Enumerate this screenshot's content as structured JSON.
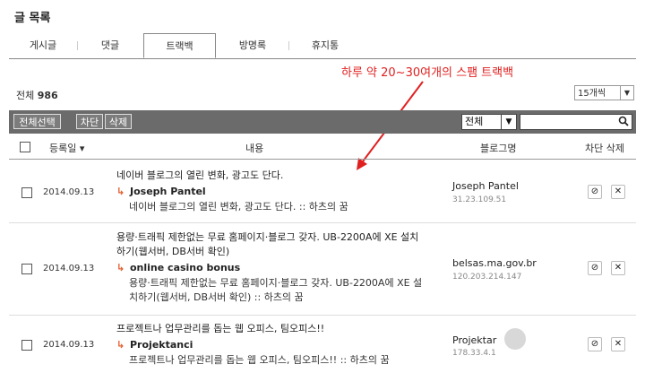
{
  "page": {
    "title": "글 목록"
  },
  "tabs": [
    {
      "label": "게시글",
      "active": false
    },
    {
      "label": "댓글",
      "active": false
    },
    {
      "label": "트랙백",
      "active": true
    },
    {
      "label": "방명록",
      "active": false
    },
    {
      "label": "휴지통",
      "active": false
    }
  ],
  "annotation": {
    "text": "하루 약 20~30여개의 스팸 트랙백",
    "color": "#e02020"
  },
  "summary": {
    "total_label": "전체",
    "total_count": "986"
  },
  "per_page": {
    "selected": "15개씩",
    "arrow": "▼"
  },
  "toolbar": {
    "select_all_label": "전체선택",
    "block_label": "차단",
    "delete_label": "삭제",
    "filter_selected": "전체",
    "filter_arrow": "▼",
    "search_value": "",
    "search_icon": "🔍"
  },
  "table": {
    "headers": {
      "date": "등록일 ▾",
      "content": "내용",
      "blog": "블로그명",
      "block_delete": "차단 삭제"
    },
    "rows": [
      {
        "date": "2014.09.13",
        "title": "네이버 블로그의 열린 변화, 광고도 단다.",
        "author": "Joseph Pantel",
        "excerpt": "네이버 블로그의 열린 변화, 광고도 단다. :: 하츠의 꿈",
        "blog_name": "Joseph Pantel",
        "blog_ip": "31.23.109.51"
      },
      {
        "date": "2014.09.13",
        "title": "용량·트래픽 제한없는 무료 홈페이지·블로그 갖자. UB-2200A에 XE 설치하기(웹서버, DB서버 확인)",
        "author": "online casino bonus",
        "excerpt": "용량·트래픽 제한없는 무료 홈페이지·블로그 갖자. UB-2200A에 XE 설치하기(웹서버, DB서버 확인) :: 하츠의 꿈",
        "blog_name": "belsas.ma.gov.br",
        "blog_ip": "120.203.214.147"
      },
      {
        "date": "2014.09.13",
        "title": "프로젝트나 업무관리를 돕는 웹 오피스, 팀오피스!!",
        "author": "Projektanci",
        "excerpt": "프로젝트나 업무관리를 돕는 웹 오피스, 팀오피스!! :: 하츠의 꿈",
        "blog_name": "Projektar",
        "blog_ip": "178.33.4.1"
      }
    ],
    "reply_arrow": "↳",
    "block_icon": "⊘",
    "delete_icon": "✕"
  }
}
